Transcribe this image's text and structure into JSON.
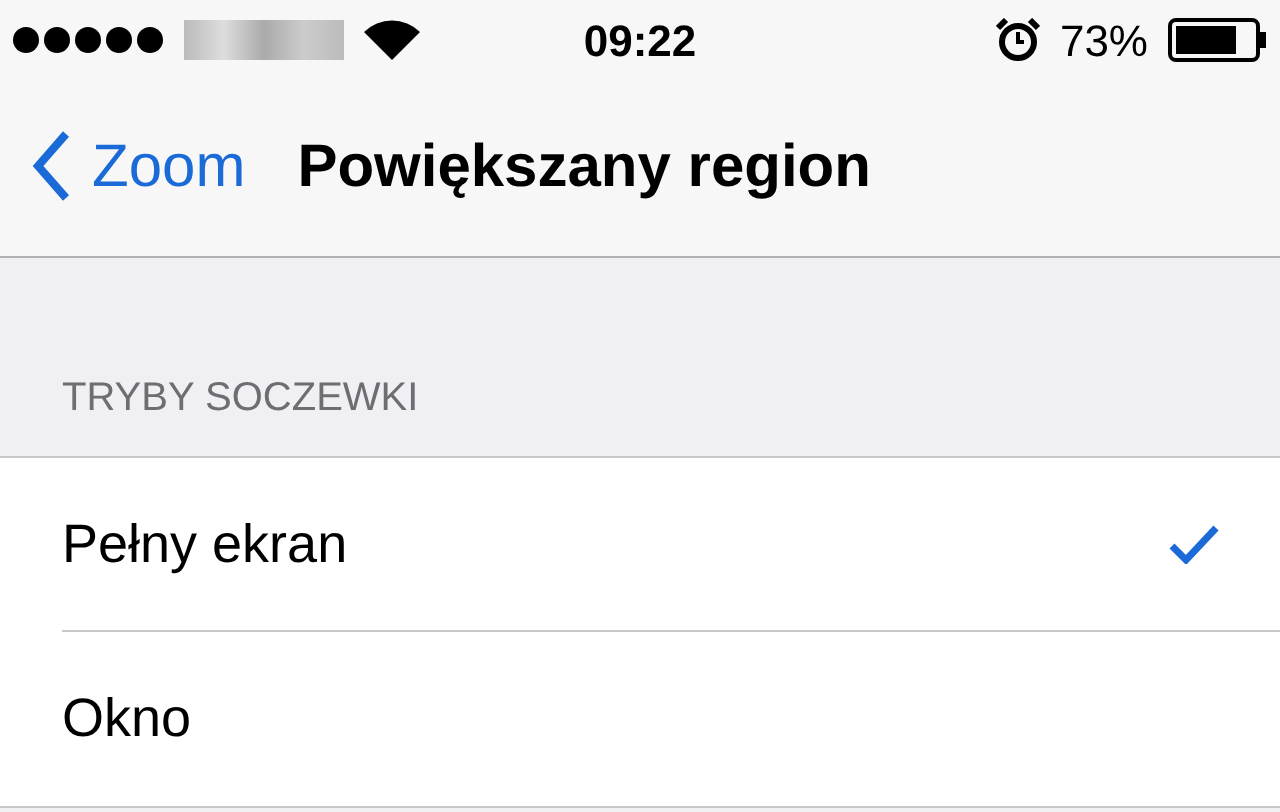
{
  "status_bar": {
    "time": "09:22",
    "battery": "73%"
  },
  "nav_bar": {
    "back": "Zoom",
    "title": "Powiększany region"
  },
  "section": {
    "header": "TRYBY SOCZEWKI",
    "rows": [
      {
        "label": "Pełny ekran",
        "selected": true
      },
      {
        "label": "Okno",
        "selected": false
      }
    ]
  }
}
